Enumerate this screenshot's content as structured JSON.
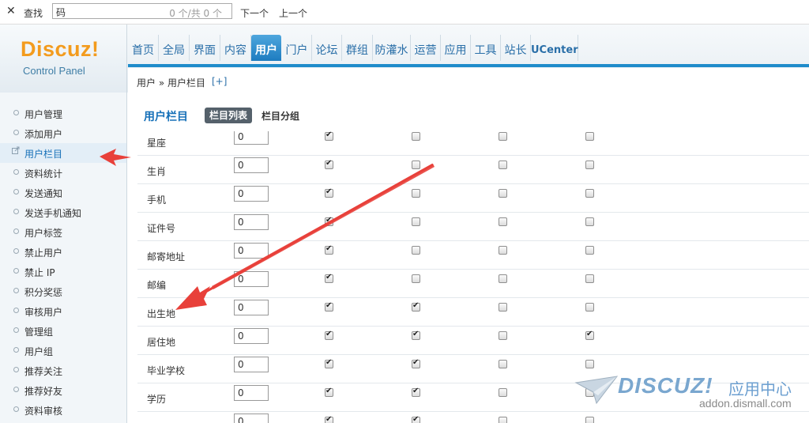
{
  "findbar": {
    "close_glyph": "✕",
    "label": "查找",
    "query": "码",
    "count": "0 个/共 0 个",
    "next": "下一个",
    "prev": "上一个"
  },
  "logo": {
    "brand": "Discuz!",
    "sub": "Control Panel"
  },
  "topnav": [
    {
      "label": "首页"
    },
    {
      "label": "全局"
    },
    {
      "label": "界面"
    },
    {
      "label": "内容"
    },
    {
      "label": "用户",
      "active": true
    },
    {
      "label": "门户"
    },
    {
      "label": "论坛"
    },
    {
      "label": "群组"
    },
    {
      "label": "防灌水"
    },
    {
      "label": "运营"
    },
    {
      "label": "应用"
    },
    {
      "label": "工具"
    },
    {
      "label": "站长"
    },
    {
      "label": "UCenter"
    }
  ],
  "breadcrumb": {
    "text": "用户 » 用户栏目",
    "plus": "[+]"
  },
  "sidebar": [
    {
      "label": "用户管理"
    },
    {
      "label": "添加用户"
    },
    {
      "label": "用户栏目",
      "active": true
    },
    {
      "label": "资料统计"
    },
    {
      "label": "发送通知"
    },
    {
      "label": "发送手机通知"
    },
    {
      "label": "用户标签"
    },
    {
      "label": "禁止用户"
    },
    {
      "label": "禁止 IP"
    },
    {
      "label": "积分奖惩"
    },
    {
      "label": "审核用户"
    },
    {
      "label": "管理组"
    },
    {
      "label": "用户组"
    },
    {
      "label": "推荐关注"
    },
    {
      "label": "推荐好友"
    },
    {
      "label": "资料审核"
    }
  ],
  "main": {
    "title": "用户栏目",
    "tab_active": "栏目列表",
    "tab_other": "栏目分组"
  },
  "rows": [
    {
      "name": "星座",
      "order": "0",
      "checks": [
        true,
        false,
        false,
        false
      ]
    },
    {
      "name": "生肖",
      "order": "0",
      "checks": [
        true,
        false,
        false,
        false
      ]
    },
    {
      "name": "手机",
      "order": "0",
      "checks": [
        true,
        false,
        false,
        false
      ]
    },
    {
      "name": "证件号",
      "order": "0",
      "checks": [
        true,
        false,
        false,
        false
      ]
    },
    {
      "name": "邮寄地址",
      "order": "0",
      "checks": [
        true,
        false,
        false,
        false
      ]
    },
    {
      "name": "邮编",
      "order": "0",
      "checks": [
        true,
        false,
        false,
        false
      ]
    },
    {
      "name": "出生地",
      "order": "0",
      "checks": [
        true,
        true,
        false,
        false
      ]
    },
    {
      "name": "居住地",
      "order": "0",
      "checks": [
        true,
        true,
        false,
        true
      ]
    },
    {
      "name": "毕业学校",
      "order": "0",
      "checks": [
        true,
        true,
        false,
        false
      ]
    },
    {
      "name": "学历",
      "order": "0",
      "checks": [
        true,
        true,
        false,
        false
      ]
    },
    {
      "name": "",
      "order": "0",
      "checks": [
        true,
        true,
        false,
        false
      ]
    }
  ],
  "watermark": {
    "brand": "DISCUZ!",
    "cn": "应用中心",
    "url": "addon.dismall.com"
  },
  "colors": {
    "accent": "#1f8ccb",
    "logo_orange": "#f39b1d",
    "arrow": "#e8403a"
  }
}
